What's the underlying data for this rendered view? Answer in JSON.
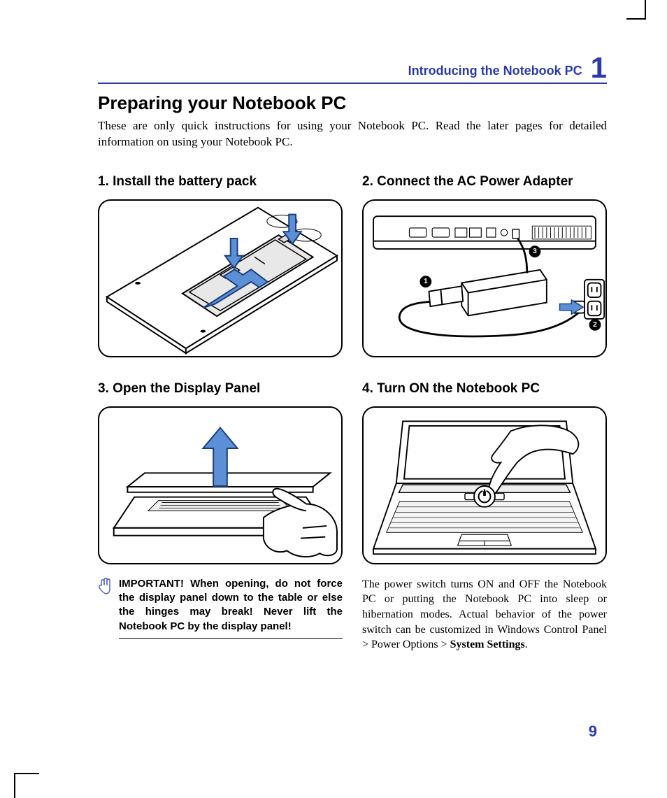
{
  "header": {
    "chapter_title": "Introducing the Notebook PC",
    "chapter_number": "1"
  },
  "main_heading": "Preparing your Notebook PC",
  "intro": "These are only quick instructions for using your Notebook PC. Read the later pages for detailed information on using your Notebook PC.",
  "steps": {
    "s1": {
      "heading": "1. Install the battery pack"
    },
    "s2": {
      "heading": "2. Connect the AC Power Adapter",
      "callouts": [
        "1",
        "2",
        "3"
      ]
    },
    "s3": {
      "heading": "3. Open the Display Panel",
      "note": "IMPORTANT!  When opening, do not force the display panel down to the table or else the hinges may break! Never lift the Notebook PC by the display panel!"
    },
    "s4": {
      "heading": "4. Turn ON the Notebook PC",
      "body_pre": "The power switch turns ON and OFF the Notebook PC or putting the Notebook PC into sleep or hibernation modes. Actual behavior of the power switch can be customized in Windows Control Panel > Power Options > ",
      "body_bold": "System Settings",
      "body_post": "."
    }
  },
  "icons": {
    "hand_stop": "hand-stop-icon",
    "power": "power-icon"
  },
  "page_number": "9"
}
